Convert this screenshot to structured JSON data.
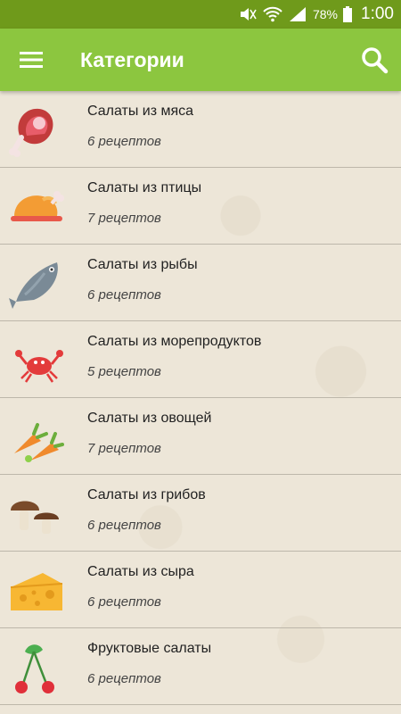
{
  "status": {
    "battery": "78%",
    "time": "1:00"
  },
  "appbar": {
    "title": "Категории"
  },
  "icons": {
    "menu": "menu-icon",
    "search": "search-icon",
    "categories": [
      "meat-icon",
      "chicken-icon",
      "fish-icon",
      "crab-icon",
      "carrot-icon",
      "mushroom-icon",
      "cheese-icon",
      "cherry-icon"
    ]
  },
  "colors": {
    "statusbar": "#6f9a1b",
    "appbar": "#8cc63f",
    "background": "#ede6d8"
  },
  "categories": [
    {
      "name": "Салаты из мяса",
      "count": "6 рецептов"
    },
    {
      "name": "Салаты из птицы",
      "count": "7 рецептов"
    },
    {
      "name": "Салаты из рыбы",
      "count": "6 рецептов"
    },
    {
      "name": "Салаты из морепродуктов",
      "count": "5 рецептов"
    },
    {
      "name": "Салаты из овощей",
      "count": "7 рецептов"
    },
    {
      "name": "Салаты из грибов",
      "count": "6 рецептов"
    },
    {
      "name": "Салаты из сыра",
      "count": "6 рецептов"
    },
    {
      "name": "Фруктовые салаты",
      "count": "6 рецептов"
    }
  ]
}
